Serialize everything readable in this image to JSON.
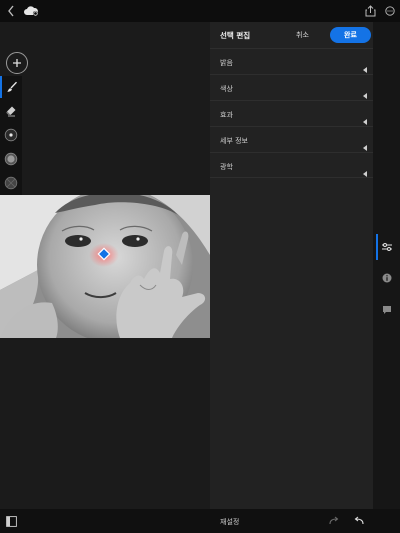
{
  "top_bar": {
    "back_icon": "chevron-left-icon",
    "cloud_icon": "cloud-sync-icon",
    "share_icon": "share-icon",
    "more_icon": "more-icon"
  },
  "left_tools": {
    "add_icon": "plus-icon",
    "tools": [
      {
        "name": "brush-icon",
        "active": true
      },
      {
        "name": "eraser-icon",
        "active": false
      },
      {
        "name": "radial-gradient-icon",
        "active": false
      },
      {
        "name": "linear-gradient-icon",
        "active": false
      },
      {
        "name": "color-range-icon",
        "active": false
      }
    ]
  },
  "edit_panel": {
    "title": "선택 편집",
    "cancel_label": "취소",
    "done_label": "완료",
    "sections": [
      "밝음",
      "색상",
      "효과",
      "세부 정보",
      "광학"
    ]
  },
  "right_bar": {
    "icons": [
      "adjust-sliders-icon",
      "info-icon",
      "comment-icon"
    ]
  },
  "bottom_bar": {
    "compare_icon": "compare-icon",
    "reset_label": "재설정",
    "redo_icon": "redo-icon",
    "undo_icon": "undo-icon"
  },
  "colors": {
    "accent": "#1473e6",
    "mask_overlay": "#ff6b6b",
    "panel_bg": "#222222",
    "app_bg": "#1b1b1b"
  }
}
